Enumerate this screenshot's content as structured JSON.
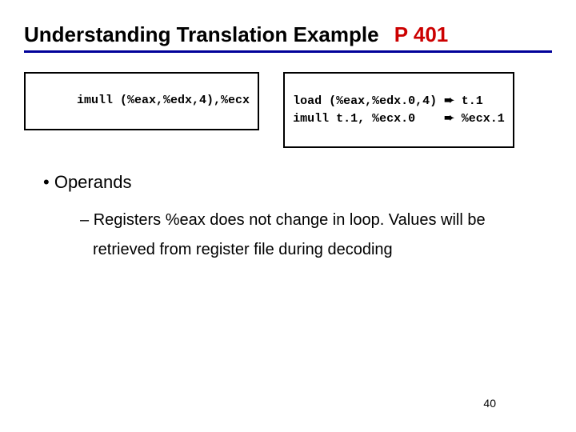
{
  "title": {
    "main": "Understanding Translation Example",
    "page_ref": "P 401"
  },
  "left_code": "imull (%eax,%edx,4),%ecx",
  "right_code": {
    "line1_left": "load (%eax,%edx.0,4)",
    "line1_arrow": "➨",
    "line1_right": " t.1",
    "line2_left": "imull t.1, %ecx.0   ",
    "line2_arrow": "➨",
    "line2_right": " %ecx.1"
  },
  "bullets": {
    "l1_marker": "•",
    "l1_text": "Operands",
    "l2_marker": "–",
    "l2_text": "Registers %eax does not change in loop.  Values will be retrieved from register file during decoding"
  },
  "pagenum": "40"
}
